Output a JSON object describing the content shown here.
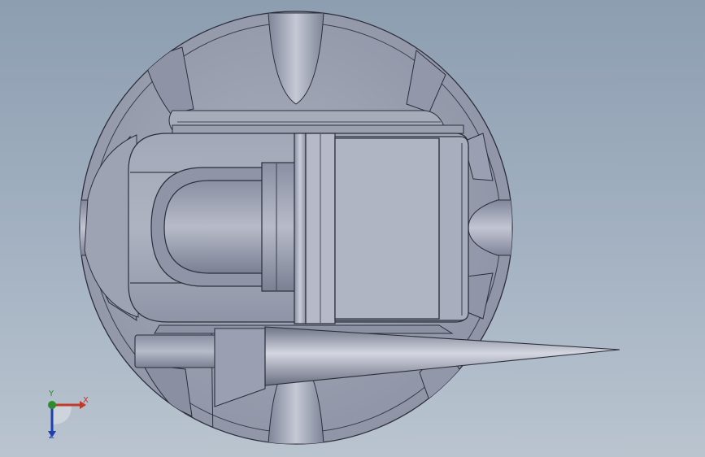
{
  "colors": {
    "background_top": "#8d9eb1",
    "background_bottom": "#b9c4cf",
    "part_light": "#b2b7c6",
    "part_mid": "#989daf",
    "part_dark": "#6b7082",
    "edge": "#2c2f3a"
  },
  "triad": {
    "x_label": "X",
    "y_label": "Y",
    "z_label": "Z",
    "x_color": "#c0392b",
    "y_color": "#2e8b2e",
    "z_color": "#1f3fb0"
  }
}
